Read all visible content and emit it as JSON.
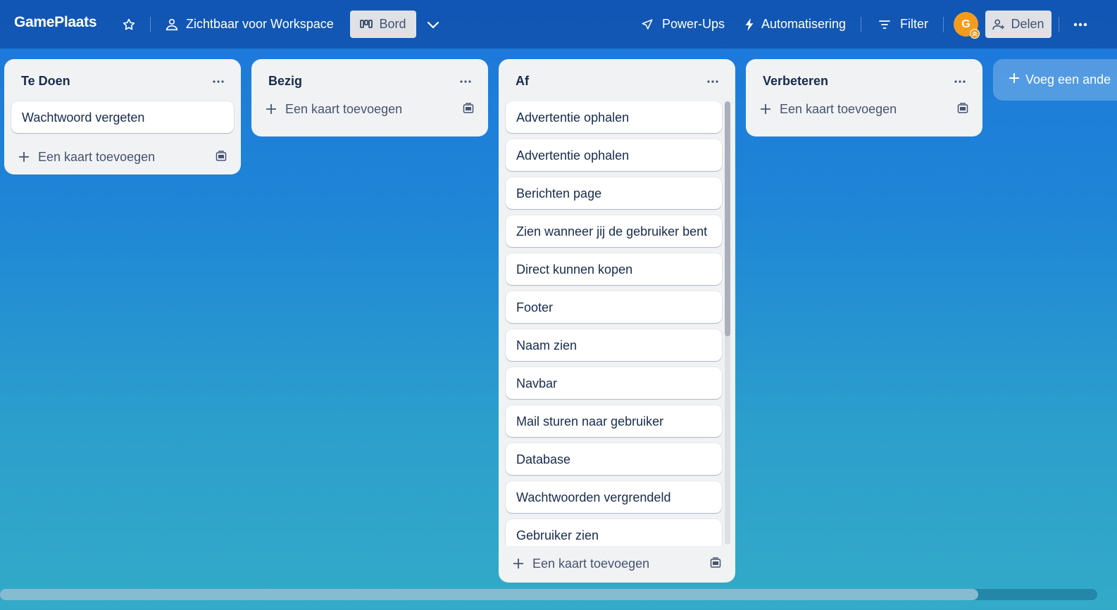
{
  "header": {
    "board_name": "GamePlaats",
    "visibility_label": "Zichtbaar voor Workspace",
    "view_label": "Bord",
    "powerups_label": "Power-Ups",
    "automation_label": "Automatisering",
    "filter_label": "Filter",
    "avatar_initial": "G",
    "share_label": "Delen"
  },
  "lists": [
    {
      "title": "Te Doen",
      "cards": [
        "Wachtwoord vergeten"
      ],
      "add_card_label": "Een kaart toevoegen"
    },
    {
      "title": "Bezig",
      "cards": [],
      "add_card_label": "Een kaart toevoegen"
    },
    {
      "title": "Af",
      "cards": [
        "Advertentie ophalen",
        "Advertentie ophalen",
        "Berichten page",
        "Zien wanneer jij de gebruiker bent",
        "Direct kunnen kopen",
        "Footer",
        "Naam zien",
        "Navbar",
        "Mail sturen naar gebruiker",
        "Database",
        "Wachtwoorden vergrendeld",
        "Gebruiker zien"
      ],
      "add_card_label": "Een kaart toevoegen"
    },
    {
      "title": "Verbeteren",
      "cards": [],
      "add_card_label": "Een kaart toevoegen"
    }
  ],
  "add_list_label": "Voeg een ande",
  "colors": {
    "background_top": "#1d76db",
    "background_bottom": "#33aac8",
    "list_bg": "#f1f2f4",
    "avatar": "#f39b1e"
  }
}
